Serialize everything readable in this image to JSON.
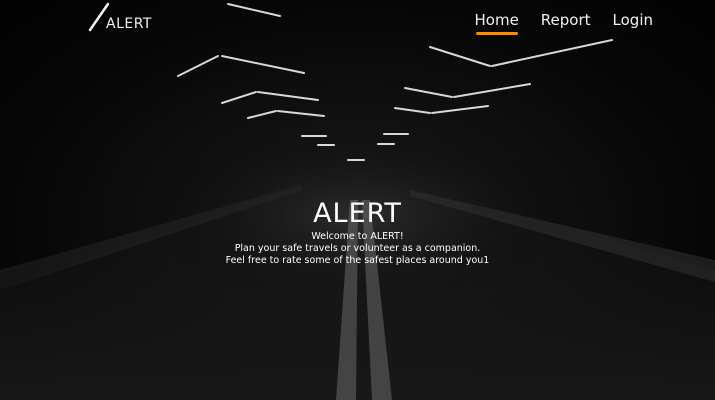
{
  "brand": {
    "name": "ALERT",
    "logo_icon": "slash-icon"
  },
  "nav": {
    "items": [
      {
        "label": "Home",
        "active": true
      },
      {
        "label": "Report",
        "active": false
      },
      {
        "label": "Login",
        "active": false
      }
    ]
  },
  "hero": {
    "title": "ALERT",
    "lines": [
      "Welcome to ALERT!",
      "Plan your safe travels or volunteer as a companion.",
      "Feel free to rate some of the safest places around you1"
    ]
  },
  "colors": {
    "background": "#000000",
    "text": "#f2f2f2",
    "accent": "#ff8c00"
  }
}
